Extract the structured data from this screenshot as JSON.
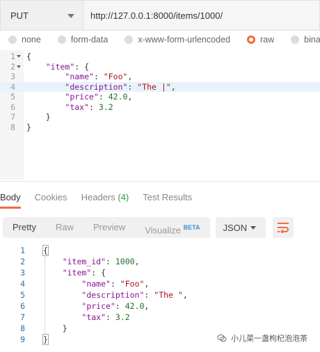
{
  "request": {
    "method": "PUT",
    "url": "http://127.0.0.1:8000/items/1000/"
  },
  "body_types": [
    "none",
    "form-data",
    "x-www-form-urlencoded",
    "raw",
    "binary"
  ],
  "body_type_selected": "raw",
  "editor": {
    "line_numbers": [
      "1",
      "2",
      "3",
      "4",
      "5",
      "6",
      "7",
      "8"
    ],
    "active_line": 4,
    "lines": {
      "l1": "{",
      "l2_key": "\"item\"",
      "l2_rest": ": {",
      "l3_key": "\"name\"",
      "l3_sep": ": ",
      "l3_val": "\"Foo\"",
      "l3_end": ",",
      "l4_key": "\"description\"",
      "l4_sep": ": ",
      "l4_val": "\"The |\"",
      "l4_end": ",",
      "l5_key": "\"price\"",
      "l5_sep": ": ",
      "l5_val": "42.0",
      "l5_end": ",",
      "l6_key": "\"tax\"",
      "l6_sep": ": ",
      "l6_val": "3.2",
      "l7": "}",
      "l8": "}"
    }
  },
  "response_tabs": {
    "body": "Body",
    "cookies": "Cookies",
    "headers": "Headers",
    "headers_count": "(4)",
    "test_results": "Test Results"
  },
  "view_modes": {
    "pretty": "Pretty",
    "raw": "Raw",
    "preview": "Preview",
    "visualize": "Visualize",
    "beta": "BETA"
  },
  "format": "JSON",
  "viewer": {
    "line_numbers": [
      "1",
      "2",
      "3",
      "4",
      "5",
      "6",
      "7",
      "8",
      "9"
    ],
    "lines": {
      "l1": "{",
      "l2_key": "\"item_id\"",
      "l2_sep": ": ",
      "l2_val": "1000",
      "l2_end": ",",
      "l3_key": "\"item\"",
      "l3_rest": ": {",
      "l4_key": "\"name\"",
      "l4_sep": ": ",
      "l4_val": "\"Foo\"",
      "l4_end": ",",
      "l5_key": "\"description\"",
      "l5_sep": ": ",
      "l5_val": "\"The \"",
      "l5_end": ",",
      "l6_key": "\"price\"",
      "l6_sep": ": ",
      "l6_val": "42.0",
      "l6_end": ",",
      "l7_key": "\"tax\"",
      "l7_sep": ": ",
      "l7_val": "3.2",
      "l8": "}",
      "l9": "}"
    }
  },
  "watermark": "小儿菜一盏枸杞泡泡茶",
  "colors": {
    "accent": "#f26b3a",
    "key": "#881391",
    "string": "#a31515",
    "number": "#1f6e2d",
    "line_number": "#2a6fa8"
  },
  "icons": {
    "method_dropdown": "chevron-down-icon",
    "format_dropdown": "chevron-down-icon",
    "wrap": "wrap-lines-icon",
    "watermark": "wechat-icon"
  }
}
